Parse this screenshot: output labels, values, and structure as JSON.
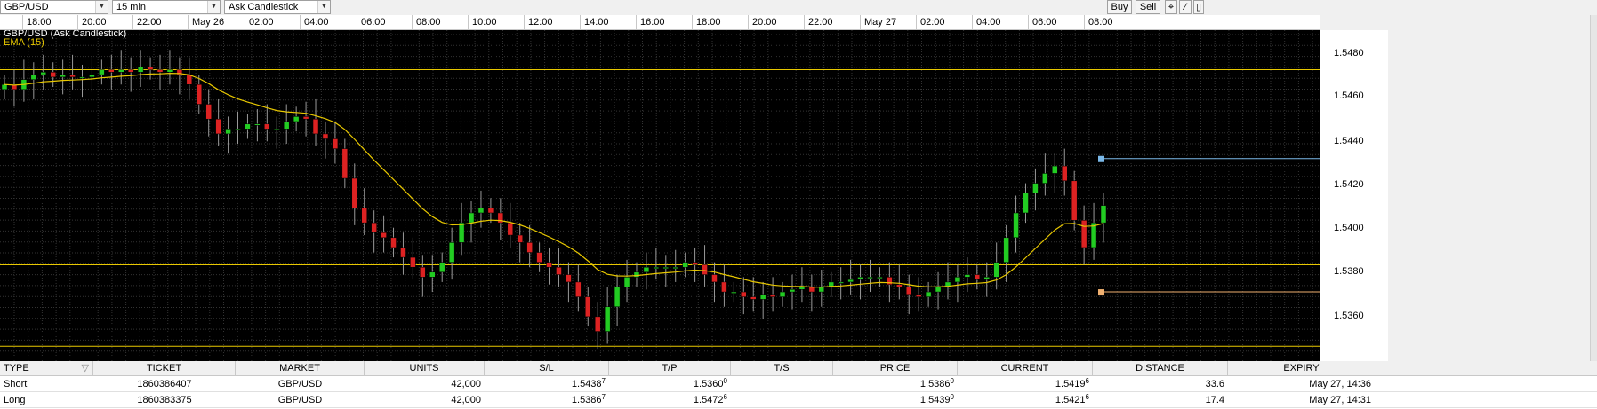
{
  "toolbar": {
    "instrument": "GBP/USD",
    "interval": "15 min",
    "chart_style": "Ask Candlestick",
    "buy_label": "Buy",
    "sell_label": "Sell"
  },
  "time_axis": [
    "18:00",
    "20:00",
    "22:00",
    "May 26",
    "02:00",
    "04:00",
    "06:00",
    "08:00",
    "10:00",
    "12:00",
    "14:00",
    "16:00",
    "18:00",
    "20:00",
    "22:00",
    "May 27",
    "02:00",
    "04:00",
    "06:00",
    "08:00"
  ],
  "chart": {
    "title": "GBP/USD (Ask Candlestick)",
    "indicator": "EMA (15)",
    "colors": {
      "up": "#22cc22",
      "down": "#dd2222",
      "ema": "#e8c800",
      "lines": "#e8c800",
      "grid": "#333333",
      "tp_marker": "#7ab8e8",
      "sl_marker": "#f0b070"
    }
  },
  "price_axis": [
    "1.5480",
    "1.5460",
    "1.5440",
    "1.5420",
    "1.5400",
    "1.5380",
    "1.5360"
  ],
  "chart_data": {
    "type": "candlestick",
    "title": "GBP/USD (Ask Candlestick)",
    "ylim": [
      1.5358,
      1.5492
    ],
    "x": [
      "18:00",
      "20:00",
      "22:00",
      "May 26",
      "02:00",
      "04:00",
      "06:00",
      "08:00",
      "10:00",
      "12:00",
      "14:00",
      "16:00",
      "18:00",
      "20:00",
      "22:00",
      "May 27",
      "02:00",
      "04:00",
      "06:00",
      "08:00"
    ],
    "horizontal_lines": [
      1.5476,
      1.5397,
      1.5364
    ],
    "markers": [
      1.544,
      1.5386
    ],
    "close": [
      1.547,
      1.5468,
      1.5472,
      1.5474,
      1.5475,
      1.5473,
      1.5474,
      1.5473,
      1.5473,
      1.5474,
      1.5476,
      1.5475,
      1.5476,
      1.5475,
      1.5477,
      1.5476,
      1.5475,
      1.5476,
      1.5474,
      1.547,
      1.5462,
      1.5456,
      1.545,
      1.5452,
      1.5452,
      1.5454,
      1.5454,
      1.5452,
      1.5452,
      1.5455,
      1.5457,
      1.5456,
      1.545,
      1.5448,
      1.5444,
      1.5432,
      1.542,
      1.5414,
      1.541,
      1.5408,
      1.5404,
      1.54,
      1.5396,
      1.5392,
      1.5394,
      1.5398,
      1.5406,
      1.5414,
      1.5418,
      1.542,
      1.5418,
      1.5414,
      1.5409,
      1.5406,
      1.5402,
      1.5398,
      1.5396,
      1.5393,
      1.539,
      1.5384,
      1.5376,
      1.537,
      1.538,
      1.5388,
      1.5392,
      1.5394,
      1.5396,
      1.5396,
      1.5396,
      1.5396,
      1.5398,
      1.5397,
      1.5393,
      1.539,
      1.5386,
      1.5386,
      1.5384,
      1.5383,
      1.5385,
      1.5384,
      1.5386,
      1.5387,
      1.5388,
      1.5386,
      1.5388,
      1.539,
      1.539,
      1.5391,
      1.5392,
      1.5392,
      1.5392,
      1.5389,
      1.5388,
      1.5385,
      1.5384,
      1.5386,
      1.5388,
      1.539,
      1.5392,
      1.5393,
      1.5391,
      1.5392,
      1.5398,
      1.5408,
      1.5418,
      1.5426,
      1.543,
      1.5434,
      1.5437,
      1.5431,
      1.5415,
      1.5404,
      1.5414,
      1.5421
    ]
  },
  "table": {
    "headers": [
      "TYPE",
      "TICKET",
      "MARKET",
      "UNITS",
      "S/L",
      "T/P",
      "T/S",
      "PRICE",
      "CURRENT",
      "DISTANCE",
      "EXPIRY"
    ],
    "rows": [
      {
        "type": "Short",
        "ticket": "1860386407",
        "market": "GBP/USD",
        "units": "42,000",
        "sl": "1.5438",
        "sl_sup": "7",
        "tp": "1.5360",
        "tp_sup": "0",
        "ts": "",
        "price": "1.5386",
        "price_sup": "0",
        "current": "1.5419",
        "current_sup": "6",
        "distance": "33.6",
        "expiry": "May 27, 14:36"
      },
      {
        "type": "Long",
        "ticket": "1860383375",
        "market": "GBP/USD",
        "units": "42,000",
        "sl": "1.5386",
        "sl_sup": "7",
        "tp": "1.5472",
        "tp_sup": "6",
        "ts": "",
        "price": "1.5439",
        "price_sup": "0",
        "current": "1.5421",
        "current_sup": "6",
        "distance": "17.4",
        "expiry": "May 27, 14:31"
      }
    ]
  }
}
